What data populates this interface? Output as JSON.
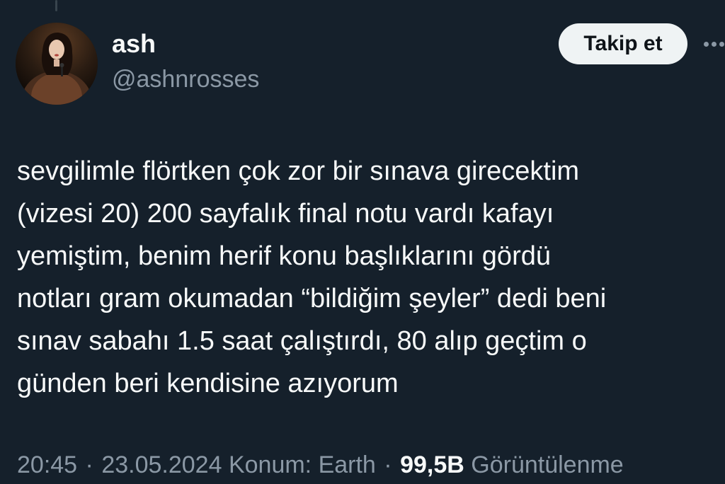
{
  "theme": {
    "background": "#15202b",
    "text_primary": "#f7f9f9",
    "text_secondary": "#8b98a5",
    "button_background": "#eff3f4",
    "button_text": "#0f1419"
  },
  "author": {
    "display_name": "ash",
    "handle": "@ashnrosses",
    "avatar_icon": "user-avatar-photo"
  },
  "actions": {
    "follow_label": "Takip et",
    "more_icon": "more-horizontal-icon"
  },
  "tweet": {
    "lines": [
      "sevgilimle flörtken çok zor bir sınava girecektim",
      "(vizesi 20) 200 sayfalık final notu vardı kafayı",
      "yemiştim, benim herif konu başlıklarını gördü",
      "notları gram okumadan “bildiğim şeyler” dedi beni",
      "sınav sabahı 1.5 saat çalıştırdı, 80 alıp geçtim o",
      "günden beri kendisine azıyorum"
    ]
  },
  "meta": {
    "time": "20:45",
    "date": "23.05.2024",
    "location": "Konum: Earth",
    "separator": "·",
    "views_count": "99,5B",
    "views_label": "Görüntülenme"
  }
}
